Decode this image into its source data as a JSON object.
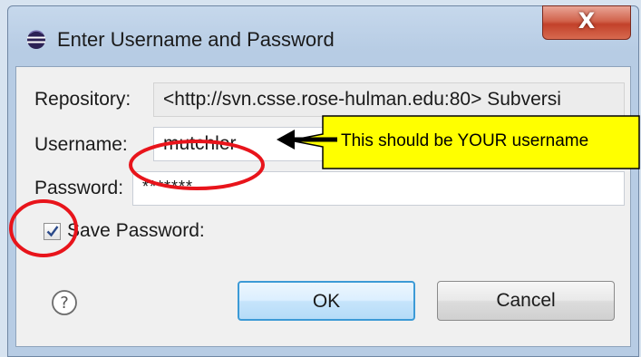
{
  "dialog": {
    "title": "Enter Username and Password",
    "close_label": "X",
    "repository_label": "Repository:",
    "repository_value": "<http://svn.csse.rose-hulman.edu:80> Subversi",
    "username_label": "Username:",
    "username_value": "mutchler",
    "password_label": "Password:",
    "password_mask": "*******",
    "save_password_label": "Save Password:",
    "save_password_checked": true,
    "ok_label": "OK",
    "cancel_label": "Cancel"
  },
  "annotation": {
    "callout_text": "This should be YOUR username",
    "callout_color": "#ffff00",
    "highlight_color": "#e8141b"
  },
  "icons": {
    "app": "eclipse-icon",
    "help": "help-icon",
    "close": "close-icon"
  }
}
